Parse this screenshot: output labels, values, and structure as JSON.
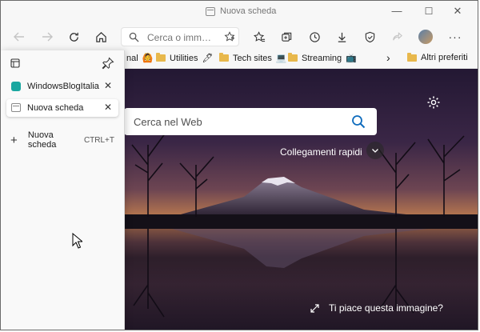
{
  "window": {
    "title": "Nuova scheda",
    "minimize_icon": "minimize-icon",
    "maximize_icon": "maximize-icon",
    "close_icon": "close-icon"
  },
  "toolbar": {
    "address_placeholder": "Cerca o imm…",
    "icons": [
      "back-icon",
      "forward-icon",
      "refresh-icon",
      "home-icon",
      "add-favorite-icon",
      "favorites-icon",
      "collections-icon",
      "history-icon",
      "downloads-icon",
      "browser-essentials-icon",
      "share-icon",
      "profile-avatar",
      "more-icon"
    ]
  },
  "favorites": {
    "items": [
      {
        "label": "nal",
        "emoji": "🙆"
      },
      {
        "label": "Utilities",
        "emoji": "🖊"
      },
      {
        "label": "Tech sites",
        "emoji": "💻"
      },
      {
        "label": "Streaming",
        "emoji": "📺"
      }
    ],
    "more": "›",
    "other": "Altri preferiti"
  },
  "vertical_tabs": {
    "tabs": [
      {
        "label": "WindowsBlogItalia | W",
        "active": false,
        "favicon_color": "#1aa7a0"
      },
      {
        "label": "Nuova scheda",
        "active": true
      }
    ],
    "new_tab_label": "Nuova scheda",
    "new_tab_shortcut": "CTRL+T"
  },
  "new_tab_page": {
    "search_placeholder": "Cerca nel Web",
    "quick_links": "Collegamenti rapidi",
    "image_credit": "Ti piace questa immagine?"
  },
  "colors": {
    "accent": "#0f6cbd",
    "chrome": "#f7f7f7",
    "folder": "#e8b84c"
  }
}
